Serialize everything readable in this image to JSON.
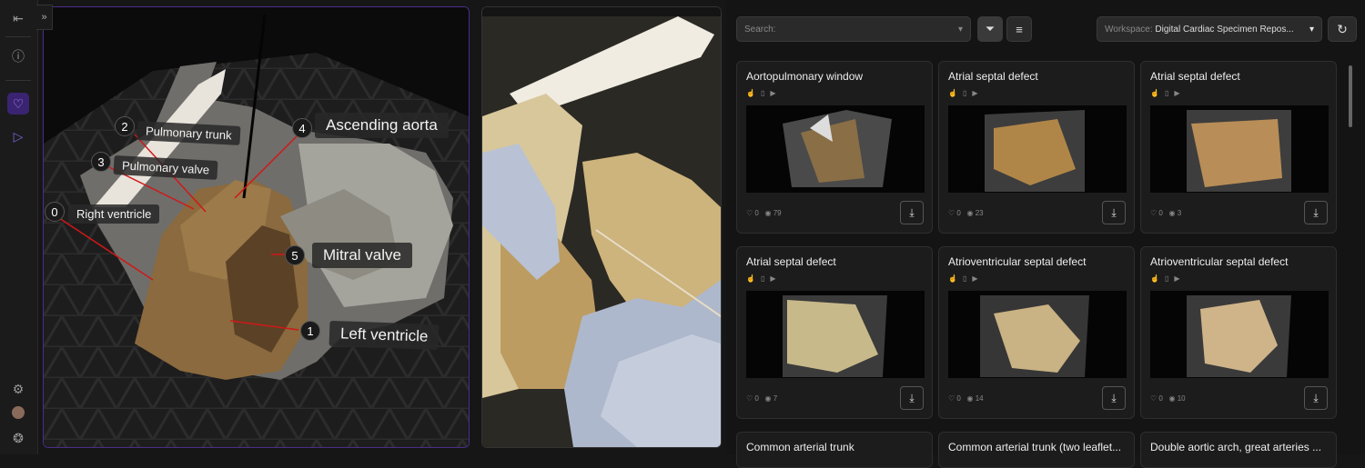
{
  "sidebar": {
    "icons": [
      "exit-icon",
      "info-icon",
      "heart-icon",
      "video-icon",
      "gear-icon",
      "avatar",
      "logo-icon"
    ]
  },
  "viewer": {
    "labels": [
      {
        "num": "2",
        "text": "Pulmonary trunk"
      },
      {
        "num": "4",
        "text": "Ascending aorta"
      },
      {
        "num": "3",
        "text": "Pulmonary valve"
      },
      {
        "num": "0",
        "text": "Right ventricle"
      },
      {
        "num": "5",
        "text": "Mitral valve"
      },
      {
        "num": "1",
        "text": "Left ventricle"
      }
    ]
  },
  "toolbar": {
    "search_placeholder": "Search:",
    "workspace_label": "Workspace:",
    "workspace_value": "Digital Cardiac Specimen Repos..."
  },
  "cards": [
    {
      "title": "Aortopulmonary window",
      "likes": "0",
      "views": "79"
    },
    {
      "title": "Atrial septal defect",
      "likes": "0",
      "views": "23"
    },
    {
      "title": "Atrial septal defect",
      "likes": "0",
      "views": "3"
    },
    {
      "title": "Atrial septal defect",
      "likes": "0",
      "views": "7"
    },
    {
      "title": "Atrioventricular septal defect",
      "likes": "0",
      "views": "14"
    },
    {
      "title": "Atrioventricular septal defect",
      "likes": "0",
      "views": "10"
    },
    {
      "title": "Common arterial trunk"
    },
    {
      "title": "Common arterial trunk (two leaflet..."
    },
    {
      "title": "Double aortic arch, great arteries ..."
    }
  ],
  "colors": {
    "accent": "#6b3fd6",
    "panel": "#1c1c1c"
  }
}
